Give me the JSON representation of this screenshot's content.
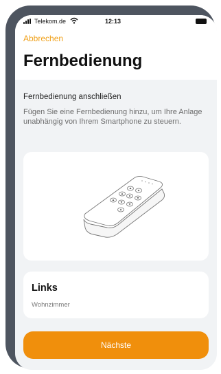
{
  "status_bar": {
    "carrier": "Telekom.de",
    "time": "12:13",
    "icons": [
      "signal-icon",
      "wifi-icon",
      "battery-icon"
    ]
  },
  "nav": {
    "cancel_label": "Abbrechen",
    "title": "Fernbedienung"
  },
  "content": {
    "heading": "Fernbedienung anschließen",
    "description": "Fügen Sie eine Fernbedienung hinzu, um Ihre Anlage unabhängig von Ihrem Smartphone zu steuern.",
    "illustration": "remote-control-illustration"
  },
  "location": {
    "name": "Links",
    "room": "Wohnzimmer"
  },
  "footer": {
    "next_label": "Nächste"
  },
  "colors": {
    "accent": "#f08f0c",
    "link": "#f0a11b",
    "background": "#f1f3f5",
    "card": "#ffffff"
  }
}
